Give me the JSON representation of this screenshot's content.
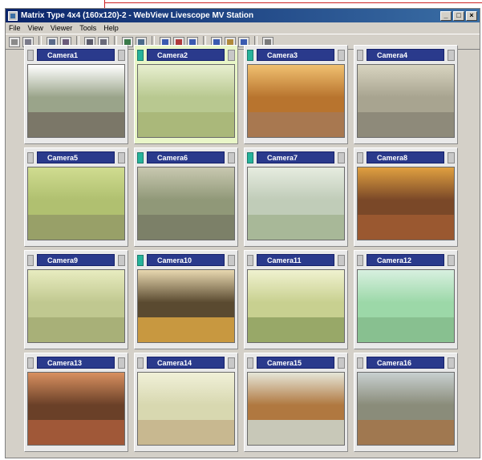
{
  "window": {
    "title": "Matrix Type 4x4 (160x120)-2 - WebView Livescope MV Station",
    "controls": {
      "minimize": "_",
      "maximize": "□",
      "close": "×"
    }
  },
  "menu": [
    "File",
    "View",
    "Viewer",
    "Tools",
    "Help"
  ],
  "toolbar": {
    "icons": [
      "matrix-layout-icon",
      "tool-icon",
      "camera-icon",
      "camera-settings-icon",
      "record-icon",
      "playback-icon",
      "photo-icon",
      "grid-view-icon",
      "monitor-icon",
      "alarm-icon",
      "sequence-icon",
      "zoom-icon",
      "settings-icon",
      "network-icon"
    ]
  },
  "cameras": [
    {
      "label": "Camera1",
      "indicator": "off",
      "scene": {
        "bg": "#9aa48a",
        "floor": "#7b7768",
        "accent": "#ffffff"
      }
    },
    {
      "label": "Camera2",
      "indicator": "on",
      "active": true,
      "scene": {
        "bg": "#b8c890",
        "floor": "#aab87a",
        "accent": "#e8efd0"
      }
    },
    {
      "label": "Camera3",
      "indicator": "on",
      "scene": {
        "bg": "#b8742e",
        "floor": "#a87850",
        "accent": "#f0c070"
      }
    },
    {
      "label": "Camera4",
      "indicator": "off",
      "scene": {
        "bg": "#a8a490",
        "floor": "#8e8a7a",
        "accent": "#d8d4c0"
      }
    },
    {
      "label": "Camera5",
      "indicator": "off",
      "scene": {
        "bg": "#b0c070",
        "floor": "#98a068",
        "accent": "#d0dc90"
      }
    },
    {
      "label": "Camera6",
      "indicator": "on",
      "scene": {
        "bg": "#909878",
        "floor": "#7c8068",
        "accent": "#c8c8b0"
      }
    },
    {
      "label": "Camera7",
      "indicator": "on",
      "scene": {
        "bg": "#c0ccb8",
        "floor": "#a8b898",
        "accent": "#e6ece0"
      }
    },
    {
      "label": "Camera8",
      "indicator": "off",
      "scene": {
        "bg": "#7a4828",
        "floor": "#9a5830",
        "accent": "#e0a040"
      }
    },
    {
      "label": "Camera9",
      "indicator": "off",
      "scene": {
        "bg": "#c0c890",
        "floor": "#a8b078",
        "accent": "#e8ecc0"
      }
    },
    {
      "label": "Camera10",
      "indicator": "on",
      "scene": {
        "bg": "#5a4a30",
        "floor": "#c89840",
        "accent": "#e8d8b0"
      }
    },
    {
      "label": "Camera11",
      "indicator": "off",
      "scene": {
        "bg": "#c8d090",
        "floor": "#98a868",
        "accent": "#f0f2d0"
      }
    },
    {
      "label": "Camera12",
      "indicator": "off",
      "scene": {
        "bg": "#9cd8a8",
        "floor": "#88c090",
        "accent": "#d8f0e0"
      }
    },
    {
      "label": "Camera13",
      "indicator": "off",
      "scene": {
        "bg": "#6a4028",
        "floor": "#a05838",
        "accent": "#d89060"
      }
    },
    {
      "label": "Camera14",
      "indicator": "off",
      "scene": {
        "bg": "#d8d8b0",
        "floor": "#c8b890",
        "accent": "#f0f0d8"
      }
    },
    {
      "label": "Camera15",
      "indicator": "off",
      "scene": {
        "bg": "#b07840",
        "floor": "#c8c8b8",
        "accent": "#e6e6d8"
      }
    },
    {
      "label": "Camera16",
      "indicator": "off",
      "scene": {
        "bg": "#8a8c7a",
        "floor": "#a07850",
        "accent": "#c8d0d0"
      }
    }
  ]
}
